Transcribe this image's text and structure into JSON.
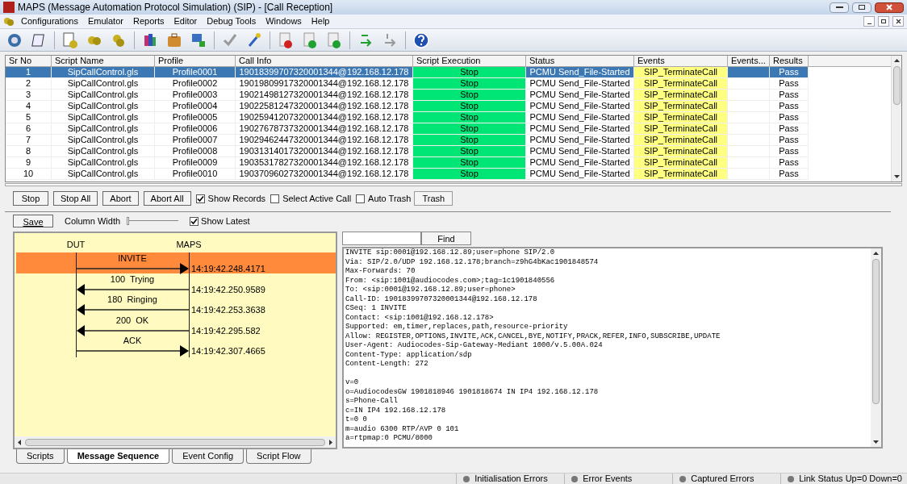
{
  "window": {
    "title": "MAPS (Message Automation Protocol Simulation) (SIP)  - [Call Reception]"
  },
  "menu": [
    "Configurations",
    "Emulator",
    "Reports",
    "Editor",
    "Debug Tools",
    "Windows",
    "Help"
  ],
  "table": {
    "columns": [
      "Sr No",
      "Script Name",
      "Profile",
      "Call Info",
      "Script Execution",
      "Status",
      "Events",
      "Events...",
      "Results"
    ],
    "rows": [
      {
        "sr_no": "1",
        "script_name": "SipCallControl.gls",
        "profile": "Profile0001",
        "call_info": "19018399707320001344@192.168.12.178",
        "script_execution": "Stop",
        "status": "PCMU Send_File-Started",
        "events": "SIP_TerminateCall",
        "results": "Pass",
        "selected": true
      },
      {
        "sr_no": "2",
        "script_name": "SipCallControl.gls",
        "profile": "Profile0002",
        "call_info": "19019809917320001344@192.168.12.178",
        "script_execution": "Stop",
        "status": "PCMU Send_File-Started",
        "events": "SIP_TerminateCall",
        "results": "Pass",
        "selected": false
      },
      {
        "sr_no": "3",
        "script_name": "SipCallControl.gls",
        "profile": "Profile0003",
        "call_info": "19021498127320001344@192.168.12.178",
        "script_execution": "Stop",
        "status": "PCMU Send_File-Started",
        "events": "SIP_TerminateCall",
        "results": "Pass",
        "selected": false
      },
      {
        "sr_no": "4",
        "script_name": "SipCallControl.gls",
        "profile": "Profile0004",
        "call_info": "19022581247320001344@192.168.12.178",
        "script_execution": "Stop",
        "status": "PCMU Send_File-Started",
        "events": "SIP_TerminateCall",
        "results": "Pass",
        "selected": false
      },
      {
        "sr_no": "5",
        "script_name": "SipCallControl.gls",
        "profile": "Profile0005",
        "call_info": "19025941207320001344@192.168.12.178",
        "script_execution": "Stop",
        "status": "PCMU Send_File-Started",
        "events": "SIP_TerminateCall",
        "results": "Pass",
        "selected": false
      },
      {
        "sr_no": "6",
        "script_name": "SipCallControl.gls",
        "profile": "Profile0006",
        "call_info": "19027678737320001344@192.168.12.178",
        "script_execution": "Stop",
        "status": "PCMU Send_File-Started",
        "events": "SIP_TerminateCall",
        "results": "Pass",
        "selected": false
      },
      {
        "sr_no": "7",
        "script_name": "SipCallControl.gls",
        "profile": "Profile0007",
        "call_info": "19029462447320001344@192.168.12.178",
        "script_execution": "Stop",
        "status": "PCMU Send_File-Started",
        "events": "SIP_TerminateCall",
        "results": "Pass",
        "selected": false
      },
      {
        "sr_no": "8",
        "script_name": "SipCallControl.gls",
        "profile": "Profile0008",
        "call_info": "19031314017320001344@192.168.12.178",
        "script_execution": "Stop",
        "status": "PCMU Send_File-Started",
        "events": "SIP_TerminateCall",
        "results": "Pass",
        "selected": false
      },
      {
        "sr_no": "9",
        "script_name": "SipCallControl.gls",
        "profile": "Profile0009",
        "call_info": "19035317827320001344@192.168.12.178",
        "script_execution": "Stop",
        "status": "PCMU Send_File-Started",
        "events": "SIP_TerminateCall",
        "results": "Pass",
        "selected": false
      },
      {
        "sr_no": "10",
        "script_name": "SipCallControl.gls",
        "profile": "Profile0010",
        "call_info": "19037096027320001344@192.168.12.178",
        "script_execution": "Stop",
        "status": "PCMU Send_File-Started",
        "events": "SIP_TerminateCall",
        "results": "Pass",
        "selected": false
      }
    ]
  },
  "controls": [
    {
      "kind": "button",
      "label": "Stop"
    },
    {
      "kind": "button",
      "label": "Stop All"
    },
    {
      "kind": "button",
      "label": "Abort"
    },
    {
      "kind": "button",
      "label": "Abort All"
    },
    {
      "kind": "checkbox",
      "label": "Show Records",
      "checked": true
    },
    {
      "kind": "checkbox",
      "label": "Select Active Call",
      "checked": false
    },
    {
      "kind": "checkbox",
      "label": "Auto Trash",
      "checked": false
    },
    {
      "kind": "button",
      "label": "Trash"
    }
  ],
  "sequence_toolbar": {
    "save": "Save",
    "column_width_label": "Column Width",
    "column_width": {
      "level": 0
    },
    "show_latest": {
      "label": "Show Latest",
      "checked": true
    }
  },
  "sequence": {
    "endpoints": [
      "DUT",
      "MAPS"
    ],
    "messages": [
      {
        "label": "INVITE",
        "kind": "request",
        "time": "14:19:42.248.4171",
        "selected": true
      },
      {
        "label": "100  Trying",
        "kind": "response",
        "time": "14:19:42.250.9589",
        "selected": false
      },
      {
        "label": "180  Ringing",
        "kind": "response",
        "time": "14:19:42.253.3638",
        "selected": false
      },
      {
        "label": "200  OK",
        "kind": "response",
        "time": "14:19:42.295.582",
        "selected": false
      },
      {
        "label": "ACK",
        "kind": "request",
        "time": "14:19:42.307.4665",
        "selected": false
      }
    ]
  },
  "message_detail": {
    "find_button": "Find",
    "headers": [
      "INVITE sip:0001@192.168.12.89;user=phone SIP/2.0",
      "Via: SIP/2.0/UDP 192.168.12.178;branch=z9hG4bKac1901848574",
      "Max-Forwards: 70",
      "From: <sip:1001@audiocodes.com>;tag=1c1901840556",
      "To: <sip:0001@192.168.12.89;user=phone>",
      "Call-ID: 19018399707320001344@192.168.12.178",
      "CSeq: 1 INVITE",
      "Contact: <sip:1001@192.168.12.178>",
      "Supported: em,timer,replaces,path,resource-priority",
      "Allow: REGISTER,OPTIONS,INVITE,ACK,CANCEL,BYE,NOTIFY,PRACK,REFER,INFO,SUBSCRIBE,UPDATE",
      "User-Agent: Audiocodes-Sip-Gateway-Mediant 1000/v.5.00A.024",
      "Content-Type: application/sdp",
      "Content-Length: 272"
    ],
    "body": [
      "v=0",
      "o=AudiocodesGW 1901818946 1901818674 IN IP4 192.168.12.178",
      "s=Phone-Call",
      "c=IN IP4 192.168.12.178",
      "t=0 0",
      "m=audio 6300 RTP/AVP 0 101",
      "a=rtpmap:0 PCMU/8000"
    ]
  },
  "tabs": [
    {
      "label": "Scripts",
      "selected": false
    },
    {
      "label": "Message Sequence",
      "selected": true
    },
    {
      "label": "Event Config",
      "selected": false
    },
    {
      "label": "Script Flow",
      "selected": false
    }
  ],
  "status_bar": [
    "Initialisation Errors",
    "Error Events",
    "Captured Errors",
    "Link Status Up=0 Down=0"
  ]
}
